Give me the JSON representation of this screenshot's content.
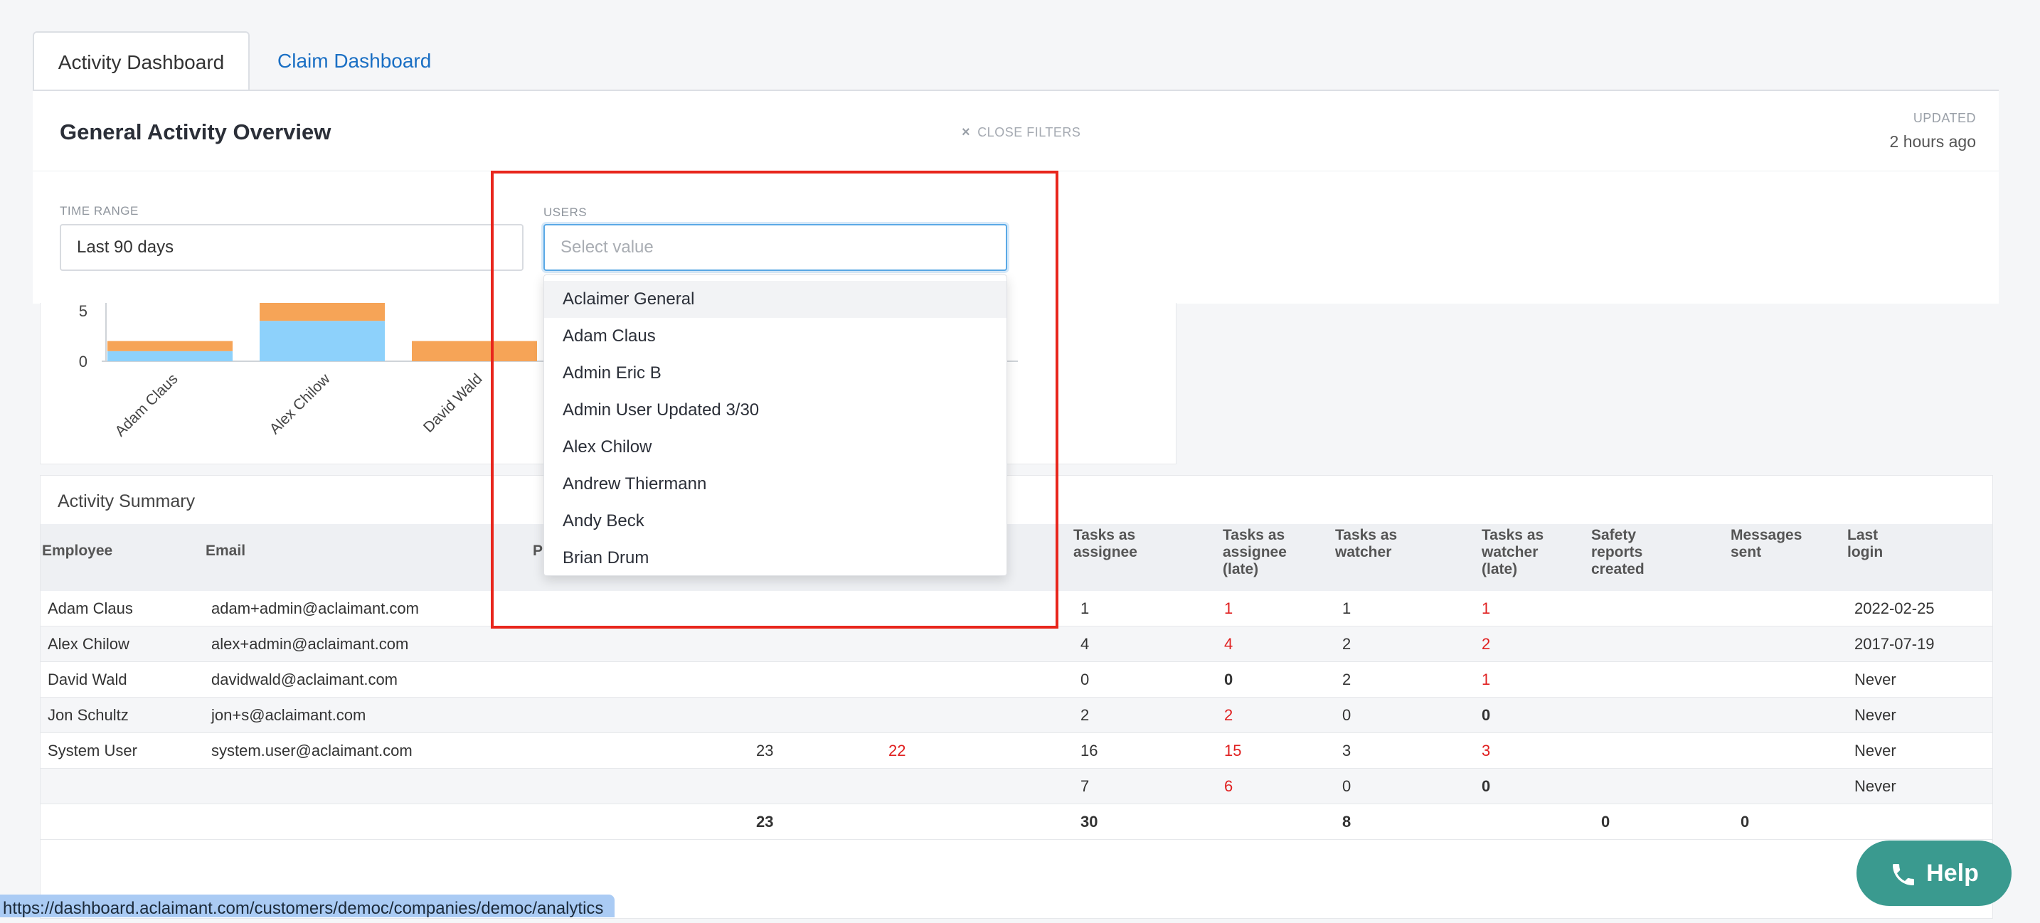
{
  "tabs": [
    {
      "label": "Activity Dashboard",
      "active": true
    },
    {
      "label": "Claim Dashboard",
      "active": false
    }
  ],
  "header": {
    "title": "General Activity Overview",
    "close_filters": "CLOSE FILTERS",
    "updated_label": "UPDATED",
    "updated_value": "2 hours ago"
  },
  "filters": {
    "time_range_label": "TIME RANGE",
    "time_range_value": "Last 90 days",
    "users_label": "USERS",
    "users_placeholder": "Select value"
  },
  "dropdown": {
    "options": [
      "Aclaimer General",
      "Adam Claus",
      "Admin Eric B",
      "Admin User Updated 3/30",
      "Alex Chilow",
      "Andrew Thiermann",
      "Andy Beck",
      "Brian Drum"
    ]
  },
  "chart_data": {
    "type": "bar",
    "stacked": true,
    "categories": [
      "Adam Claus",
      "Alex Chilow",
      "David Wald"
    ],
    "series": [
      {
        "color": "#8dd1fb",
        "values": [
          1,
          4,
          0
        ]
      },
      {
        "color": "#f6a457",
        "values": [
          1,
          2,
          2
        ]
      }
    ],
    "y_ticks": [
      "0",
      "5"
    ],
    "ylim": [
      0,
      6
    ]
  },
  "summary": {
    "title": "Activity Summary",
    "columns": [
      "Employee",
      "Email",
      "Pl",
      "Tasks as assignee",
      "Tasks as assignee (late)",
      "Tasks as watcher",
      "Tasks as watcher (late)",
      "Safety reports created",
      "Messages sent",
      "Last login"
    ],
    "rows": [
      {
        "employee": "Adam Claus",
        "email": "adam+admin@aclaimant.com",
        "c1": "",
        "c2": "",
        "ta": "1",
        "tal": "1",
        "tw": "1",
        "twl": "1",
        "last": "2022-02-25"
      },
      {
        "employee": "Alex Chilow",
        "email": "alex+admin@aclaimant.com",
        "c1": "",
        "c2": "",
        "ta": "4",
        "tal": "4",
        "tw": "2",
        "twl": "2",
        "last": "2017-07-19"
      },
      {
        "employee": "David Wald",
        "email": "davidwald@aclaimant.com",
        "c1": "",
        "c2": "",
        "ta": "0",
        "tal": "0",
        "tw": "2",
        "twl": "1",
        "last": "Never"
      },
      {
        "employee": "Jon Schultz",
        "email": "jon+s@aclaimant.com",
        "c1": "",
        "c2": "",
        "ta": "2",
        "tal": "2",
        "tw": "0",
        "twl": "0",
        "last": "Never"
      },
      {
        "employee": "System User",
        "email": "system.user@aclaimant.com",
        "c1": "23",
        "c2": "22",
        "ta": "16",
        "tal": "15",
        "tw": "3",
        "twl": "3",
        "last": "Never"
      },
      {
        "employee": "",
        "email": "",
        "c1": "",
        "c2": "",
        "ta": "7",
        "tal": "6",
        "tw": "0",
        "twl": "0",
        "last": "Never"
      }
    ],
    "totals": {
      "c1": "23",
      "ta": "30",
      "tw": "8",
      "safety": "0",
      "messages": "0"
    }
  },
  "help_button": {
    "label": "Help"
  },
  "status_url": "https://dashboard.aclaimant.com/customers/democ/companies/democ/analytics"
}
